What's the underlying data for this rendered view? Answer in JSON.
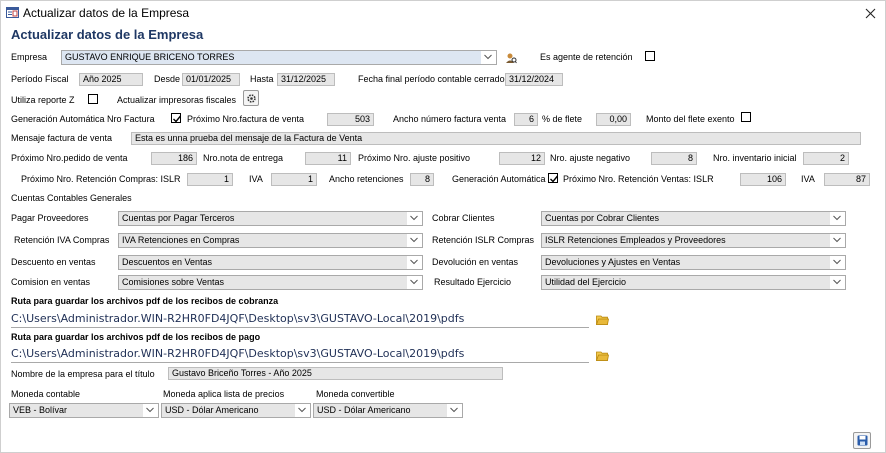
{
  "window": {
    "title": "Actualizar datos de la Empresa"
  },
  "form": {
    "heading": "Actualizar datos de la Empresa",
    "empresa": {
      "label": "Empresa",
      "value": "GUSTAVO ENRIQUE BRICENO TORRES"
    },
    "agente_retencion": {
      "label": "Es agente de retención",
      "checked": false
    },
    "periodo_fiscal": {
      "label": "Período Fiscal",
      "value": "Año 2025"
    },
    "desde": {
      "label": "Desde",
      "value": "01/01/2025"
    },
    "hasta": {
      "label": "Hasta",
      "value": "31/12/2025"
    },
    "fecha_final": {
      "label": "Fecha final período contable cerrado",
      "value": "31/12/2024"
    },
    "reporte_z": {
      "label": "Utiliza reporte Z",
      "checked": false
    },
    "impresoras": {
      "label": "Actualizar impresoras fiscales"
    },
    "gen_auto_factura": {
      "label": "Generación Automática Nro Factura",
      "checked": true
    },
    "proximo_factura": {
      "label": "Próximo Nro.factura de venta",
      "value": "503"
    },
    "ancho_factura": {
      "label": "Ancho número factura venta",
      "value": "6"
    },
    "pct_flete": {
      "label": "% de flete",
      "value": "0,00"
    },
    "flete_exento": {
      "label": "Monto del flete exento",
      "checked": false
    },
    "mensaje": {
      "label": "Mensaje factura de venta",
      "value": "Esta es unna prueba del mensaje de la Factura de Venta"
    },
    "pedido": {
      "label": "Próximo Nro.pedido de venta",
      "value": "186"
    },
    "nota_entrega": {
      "label": "Nro.nota de entrega",
      "value": "11"
    },
    "ajuste_positivo": {
      "label": "Próximo Nro. ajuste positivo",
      "value": "12"
    },
    "ajuste_negativo": {
      "label": "Nro. ajuste negativo",
      "value": "8"
    },
    "inventario_inicial": {
      "label": "Nro. inventario inicial",
      "value": "2"
    },
    "ret_compras_islr": {
      "label": "Próximo Nro. Retención Compras: ISLR",
      "value": "1"
    },
    "ret_compras_iva": {
      "label": "IVA",
      "value": "1"
    },
    "ancho_retenciones": {
      "label": "Ancho retenciones",
      "value": "8"
    },
    "gen_auto_ret": {
      "label": "Generación Automática",
      "checked": true
    },
    "ret_ventas_islr": {
      "label": "Próximo Nro. Retención Ventas: ISLR",
      "value": "106"
    },
    "ret_ventas_iva": {
      "label": "IVA",
      "value": "87"
    },
    "cuentas_title": "Cuentas Contables Generales",
    "pagar_proveedores": {
      "label": "Pagar Proveedores",
      "value": "Cuentas por Pagar Terceros"
    },
    "cobrar_clientes": {
      "label": "Cobrar Clientes",
      "value": "Cuentas por Cobrar Clientes"
    },
    "retencion_iva": {
      "label": "Retención IVA Compras",
      "value": "IVA Retenciones en Compras"
    },
    "retencion_islr": {
      "label": "Retención ISLR Compras",
      "value": "ISLR Retenciones Empleados y Proveedores"
    },
    "descuento_ventas": {
      "label": "Descuento en ventas",
      "value": "Descuentos en Ventas"
    },
    "devolucion_ventas": {
      "label": "Devolución en ventas",
      "value": "Devoluciones y Ajustes en Ventas"
    },
    "comision_ventas": {
      "label": "Comision en ventas",
      "value": "Comisiones sobre Ventas"
    },
    "resultado_ejercicio": {
      "label": "Resultado Ejercicio",
      "value": "Utilidad del Ejercicio"
    },
    "ruta_cobranza": {
      "label": "Ruta para guardar los archivos pdf de los recibos de cobranza",
      "value": "C:\\Users\\Administrador.WIN-R2HR0FD4JQF\\Desktop\\sv3\\GUSTAVO-Local\\2019\\pdfs"
    },
    "ruta_pago": {
      "label": "Ruta para guardar los archivos pdf de los recibos de pago",
      "value": "C:\\Users\\Administrador.WIN-R2HR0FD4JQF\\Desktop\\sv3\\GUSTAVO-Local\\2019\\pdfs"
    },
    "nombre_titulo": {
      "label": "Nombre de la empresa para el título",
      "value": "Gustavo Briceño Torres - Año 2025"
    },
    "moneda_contable": {
      "label": "Moneda contable",
      "value": "VEB - Bolívar"
    },
    "moneda_lista": {
      "label": "Moneda aplica lista de precios",
      "value": "USD - Dólar Americano"
    },
    "moneda_convertible": {
      "label": "Moneda convertible",
      "value": "USD - Dólar Americano"
    }
  },
  "icons": {
    "app": "form-icon",
    "close": "close-icon",
    "search": "search-person-icon",
    "gear": "gear-icon",
    "folder": "folder-icon",
    "save": "save-icon"
  },
  "colors": {
    "heading": "#1f3864",
    "field_bg": "#e6e6e6",
    "empresa_bg": "#dde6f2",
    "folder": "#e8b93a",
    "save": "#2a5caa"
  }
}
